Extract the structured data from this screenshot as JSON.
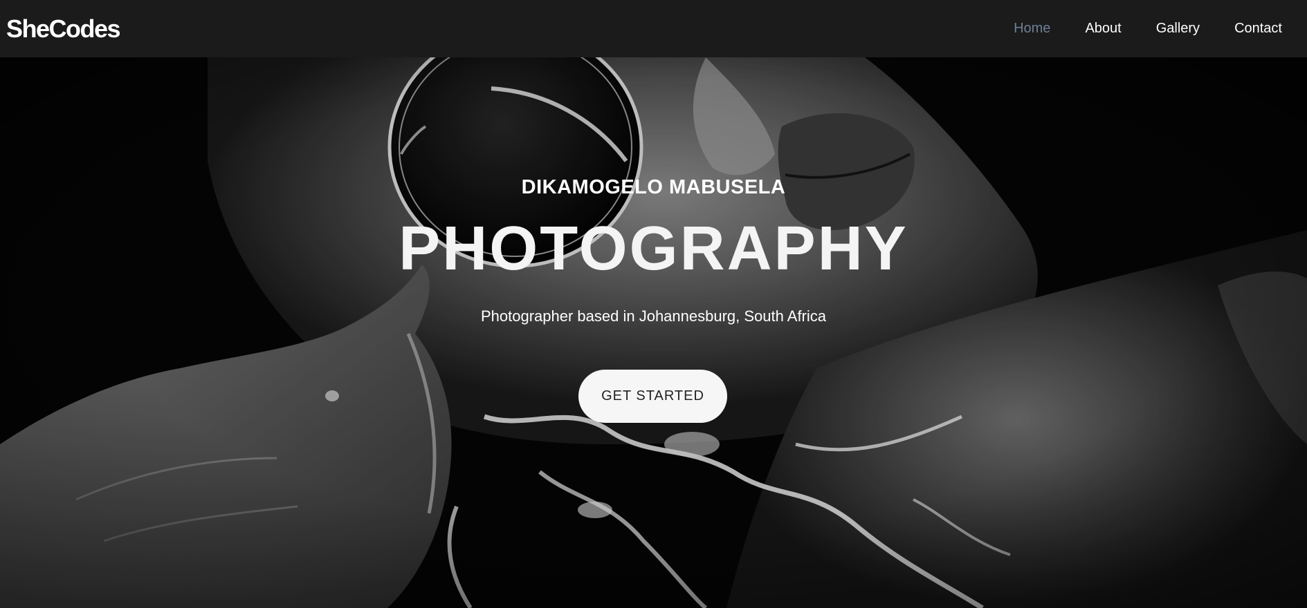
{
  "navbar": {
    "brand": "SheCodes",
    "links": [
      {
        "label": "Home",
        "active": true
      },
      {
        "label": "About",
        "active": false
      },
      {
        "label": "Gallery",
        "active": false
      },
      {
        "label": "Contact",
        "active": false
      }
    ]
  },
  "hero": {
    "owner_name": "DIKAMOGELO MABUSELA",
    "title": "PHOTOGRAPHY",
    "subtitle": "Photographer based in Johannesburg, South Africa",
    "cta_label": "GET STARTED"
  },
  "colors": {
    "navbar_background": "#1b1b1b",
    "active_link": "#6c7f95",
    "text": "#ffffff",
    "button_background": "#f6f6f6"
  }
}
